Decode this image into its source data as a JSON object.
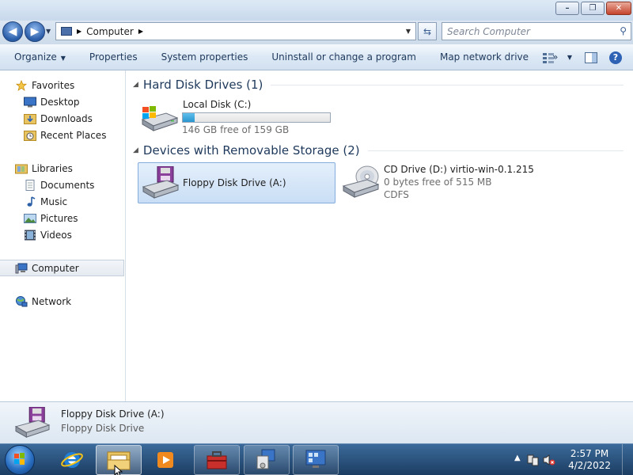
{
  "window": {
    "controls": {
      "minimize": "–",
      "maximize": "❐",
      "close": "✕"
    }
  },
  "address_bar": {
    "path": "Computer",
    "search_placeholder": "Search Computer"
  },
  "toolbar": {
    "items": [
      {
        "label": "Organize",
        "has_dropdown": true
      },
      {
        "label": "Properties"
      },
      {
        "label": "System properties"
      },
      {
        "label": "Uninstall or change a program"
      },
      {
        "label": "Map network drive"
      }
    ],
    "overflow": "»"
  },
  "nav_pane": {
    "favorites_label": "Favorites",
    "favorites": [
      "Desktop",
      "Downloads",
      "Recent Places"
    ],
    "libraries_label": "Libraries",
    "libraries": [
      "Documents",
      "Music",
      "Pictures",
      "Videos"
    ],
    "computer_label": "Computer",
    "network_label": "Network"
  },
  "content": {
    "hard_disk_group": "Hard Disk Drives (1)",
    "local_disk": {
      "name": "Local Disk (C:)",
      "free_text": "146 GB free of 159 GB",
      "used_fraction": 0.08
    },
    "removable_group": "Devices with Removable Storage (2)",
    "floppy": {
      "name": "Floppy Disk Drive (A:)"
    },
    "cd": {
      "name": "CD Drive (D:) virtio-win-0.1.215",
      "free_text": "0 bytes free of 515 MB",
      "filesystem": "CDFS"
    }
  },
  "details": {
    "name": "Floppy Disk Drive (A:)",
    "type": "Floppy Disk Drive"
  },
  "taskbar": {
    "time": "2:57 PM",
    "date": "4/2/2022"
  },
  "colors": {
    "accent": "#1e395b",
    "selection": "#c9def5",
    "taskbar": "#1c3d62"
  }
}
